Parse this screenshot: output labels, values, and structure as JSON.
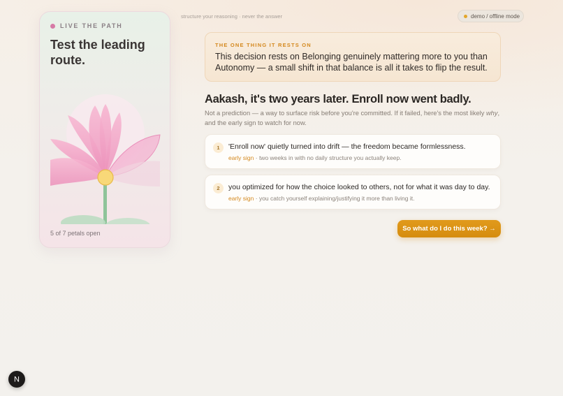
{
  "sidebar": {
    "eyebrow": "LIVE THE PATH",
    "title": "Test the leading route.",
    "petal_status": "5 of 7 petals open",
    "petals_open": 5,
    "petals_total": 7,
    "illustration_icon": "lotus-flower"
  },
  "header": {
    "tagline": "structure your reasoning · never the answer",
    "mode_badge": "demo / offline mode",
    "mode_dot_color": "#e3a62a"
  },
  "callout": {
    "label": "THE ONE THING IT RESTS ON",
    "text": "This decision rests on Belonging genuinely mattering more to you than Autonomy — a small shift in that balance is all it takes to flip the result."
  },
  "main": {
    "headline": "Aakash, it's two years later. Enroll now went badly.",
    "intro_before": "Not a prediction — a way to surface risk before you're committed. If it failed, here's the most likely ",
    "intro_emphasis": "why",
    "intro_after": ", and the early sign to watch for now.",
    "risks": [
      {
        "number": "1",
        "title": "'Enroll now' quietly turned into drift — the freedom became formlessness.",
        "sign_label": "early sign",
        "sign_text": " · two weeks in with no daily structure you actually keep."
      },
      {
        "number": "2",
        "title": "you optimized for how the choice looked to others, not for what it was day to day.",
        "sign_label": "early sign",
        "sign_text": " · you catch yourself explaining/justifying it more than living it."
      }
    ],
    "cta_label": "So what do I do this week? →"
  },
  "floating": {
    "n_button_icon": "next-logo-icon",
    "n_button_glyph": "N"
  },
  "colors": {
    "accent": "#d58c0e",
    "petal_pink": "#f2a6c8",
    "stem_green": "#8fc49a"
  }
}
